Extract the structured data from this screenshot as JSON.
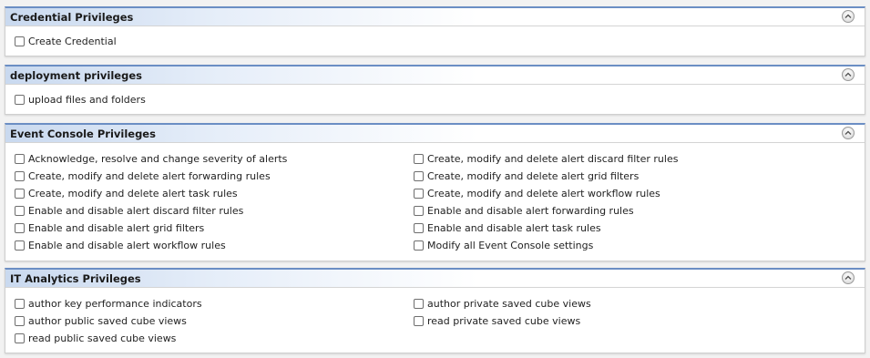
{
  "panels": [
    {
      "title": "Credential Privileges",
      "items": [
        "Create Credential"
      ]
    },
    {
      "title": "deployment privileges",
      "items": [
        "upload files and folders"
      ]
    },
    {
      "title": "Event Console Privileges",
      "items": [
        "Acknowledge, resolve and change severity of alerts",
        "Create, modify and delete alert forwarding rules",
        "Create, modify and delete alert task rules",
        "Enable and disable alert discard filter rules",
        "Enable and disable alert grid filters",
        "Enable and disable alert workflow rules",
        "Create, modify and delete alert discard filter rules",
        "Create, modify and delete alert grid filters",
        "Create, modify and delete alert workflow rules",
        "Enable and disable alert forwarding rules",
        "Enable and disable alert task rules",
        "Modify all Event Console settings"
      ]
    },
    {
      "title": "IT Analytics Privileges",
      "items": [
        "author key performance indicators",
        "author public saved cube views",
        "read public saved cube views",
        "author private saved cube views",
        "read private saved cube views"
      ]
    }
  ],
  "icons": {
    "collapse": "chevron-up-icon"
  },
  "colors": {
    "header_accent": "#6b8ec4",
    "header_gradient_start": "#c9d9ef"
  }
}
